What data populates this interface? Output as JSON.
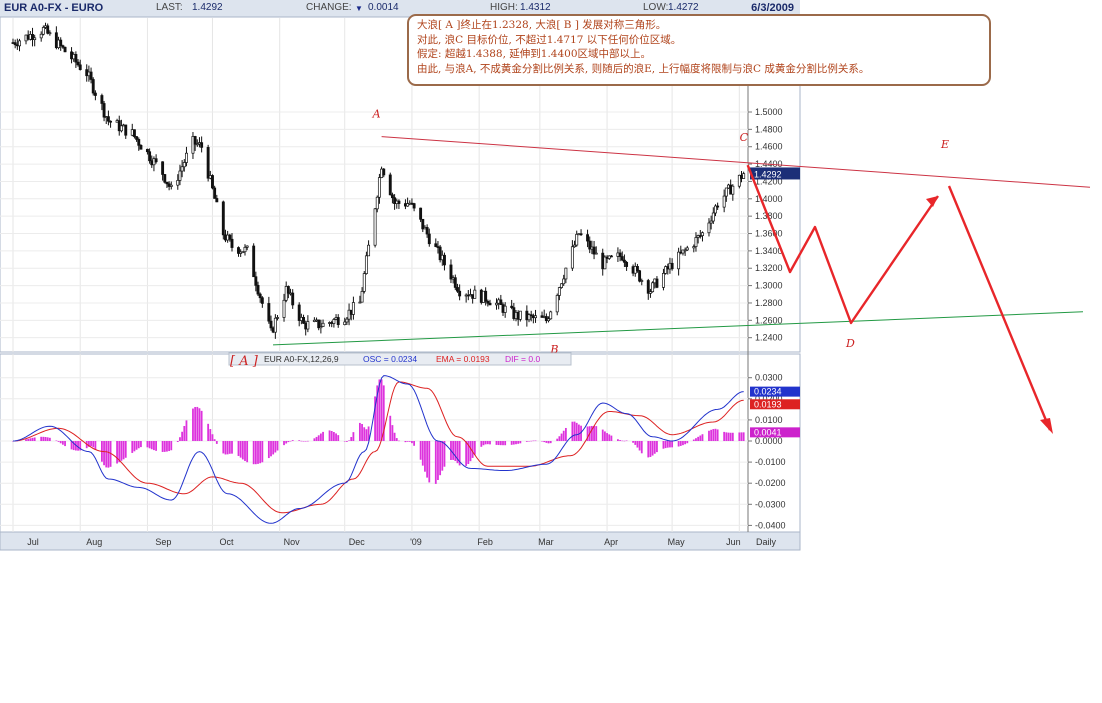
{
  "header": {
    "symbol": "EUR A0-FX - EURO",
    "last_label": "LAST:",
    "last_value": "1.4292",
    "change_label": "CHANGE:",
    "change_arrow": "▼",
    "change_value": "0.0014",
    "high_label": "HIGH:",
    "high_value": "1.4312",
    "low_label": "LOW:",
    "low_value": "1.4272",
    "date": "6/3/2009"
  },
  "annotation": {
    "lines": [
      "大浪[ A ]终止在1.2328, 大浪[ B ] 发展对称三角形。",
      "对此, 浪C 目标价位, 不超过1.4717 以下任何价位区域。",
      "假定: 超越1.4388, 延伸到1.4400区域中部以上。",
      "由此, 与浪A, 不成黄金分割比例关系, 则随后的浪E, 上行幅度将限制与浪C 成黄金分割比例关系。"
    ]
  },
  "colors": {
    "candles": "#111111",
    "osc_line": "#2233cc",
    "ema_line": "#dd2222",
    "dif_bars": "#dd33dd",
    "wave_projection": "#e8262a",
    "upper_trendline": "#cc3344",
    "lower_trendline": "#229944",
    "label_red": "#cc2222"
  },
  "chart_data": [
    {
      "type": "candlestick",
      "title": "EUR A0-FX - EURO",
      "price_axis_ticks": [
        "1.5000",
        "1.4800",
        "1.4600",
        "1.4400",
        "1.4200",
        "1.4000",
        "1.3800",
        "1.3600",
        "1.3400",
        "1.3200",
        "1.3000",
        "1.2800",
        "1.2600",
        "1.2400"
      ],
      "last_price_tag": "1.4292",
      "ylim": [
        1.23,
        1.51
      ],
      "x_ticks": [
        "Jul",
        "Aug",
        "Sep",
        "Oct",
        "Nov",
        "Dec",
        "'09",
        "Feb",
        "Mar",
        "Apr",
        "May",
        "Jun"
      ],
      "x_suffix": "Daily",
      "close_anchors": [
        {
          "date": "2008-07-01",
          "value": 1.58
        },
        {
          "date": "2008-07-15",
          "value": 1.595
        },
        {
          "date": "2008-07-23",
          "value": 1.575
        },
        {
          "date": "2008-08-04",
          "value": 1.545
        },
        {
          "date": "2008-08-14",
          "value": 1.49
        },
        {
          "date": "2008-08-25",
          "value": 1.475
        },
        {
          "date": "2008-09-08",
          "value": 1.43
        },
        {
          "date": "2008-09-12",
          "value": 1.41
        },
        {
          "date": "2008-09-22",
          "value": 1.465
        },
        {
          "date": "2008-09-26",
          "value": 1.46
        },
        {
          "date": "2008-10-06",
          "value": 1.36
        },
        {
          "date": "2008-10-10",
          "value": 1.345
        },
        {
          "date": "2008-10-17",
          "value": 1.34
        },
        {
          "date": "2008-10-28",
          "value": 1.245
        },
        {
          "date": "2008-11-04",
          "value": 1.295
        },
        {
          "date": "2008-11-12",
          "value": 1.255
        },
        {
          "date": "2008-11-21",
          "value": 1.255
        },
        {
          "date": "2008-12-01",
          "value": 1.265
        },
        {
          "date": "2008-12-08",
          "value": 1.28
        },
        {
          "date": "2008-12-18",
          "value": 1.44
        },
        {
          "date": "2008-12-24",
          "value": 1.395
        },
        {
          "date": "2008-12-31",
          "value": 1.395
        },
        {
          "date": "2009-01-09",
          "value": 1.355
        },
        {
          "date": "2009-01-23",
          "value": 1.295
        },
        {
          "date": "2009-02-05",
          "value": 1.285
        },
        {
          "date": "2009-02-18",
          "value": 1.265
        },
        {
          "date": "2009-03-04",
          "value": 1.26
        },
        {
          "date": "2009-03-19",
          "value": 1.36
        },
        {
          "date": "2009-03-30",
          "value": 1.325
        },
        {
          "date": "2009-04-08",
          "value": 1.335
        },
        {
          "date": "2009-04-21",
          "value": 1.295
        },
        {
          "date": "2009-05-01",
          "value": 1.325
        },
        {
          "date": "2009-05-15",
          "value": 1.36
        },
        {
          "date": "2009-05-22",
          "value": 1.395
        },
        {
          "date": "2009-06-03",
          "value": 1.4292
        }
      ],
      "annotations": [
        {
          "label": "[ A ]",
          "date": "2008-10-28",
          "value": 1.2328
        },
        {
          "label": "A",
          "date": "2008-12-18",
          "value": 1.4717
        },
        {
          "label": "B",
          "date": "2009-03-04",
          "value": 1.2456
        },
        {
          "label": "C",
          "date": "2009-06-03",
          "value": 1.4388
        },
        {
          "label": "D",
          "projected": true
        },
        {
          "label": "E",
          "projected": true
        }
      ]
    },
    {
      "type": "line",
      "title": "EUR A0-FX,12,26,9",
      "legend": [
        {
          "name": "OSC",
          "value": "0.0234"
        },
        {
          "name": "EMA",
          "value": "0.0193"
        },
        {
          "name": "DIF",
          "value": "0.0"
        }
      ],
      "axis_ticks": [
        "0.0300",
        "0.0200",
        "0.0100",
        "0.0000",
        "-0.0100",
        "-0.0200",
        "-0.0300",
        "-0.0400"
      ],
      "value_tags": [
        "0.0234",
        "0.0193",
        "0.0041"
      ],
      "ylim": [
        -0.041,
        0.034
      ],
      "series": [
        {
          "name": "OSC",
          "anchors": [
            {
              "date": "2008-07-01",
              "value": 0.0
            },
            {
              "date": "2008-07-18",
              "value": 0.007
            },
            {
              "date": "2008-08-05",
              "value": -0.005
            },
            {
              "date": "2008-08-14",
              "value": -0.018
            },
            {
              "date": "2008-08-28",
              "value": -0.022
            },
            {
              "date": "2008-09-12",
              "value": -0.028
            },
            {
              "date": "2008-09-25",
              "value": -0.005
            },
            {
              "date": "2008-10-08",
              "value": -0.025
            },
            {
              "date": "2008-10-28",
              "value": -0.039
            },
            {
              "date": "2008-11-10",
              "value": -0.032
            },
            {
              "date": "2008-12-01",
              "value": -0.02
            },
            {
              "date": "2008-12-10",
              "value": -0.005
            },
            {
              "date": "2008-12-19",
              "value": 0.031
            },
            {
              "date": "2008-12-30",
              "value": 0.027
            },
            {
              "date": "2009-01-13",
              "value": 0.0
            },
            {
              "date": "2009-01-28",
              "value": -0.013
            },
            {
              "date": "2009-02-13",
              "value": -0.014
            },
            {
              "date": "2009-03-04",
              "value": -0.011
            },
            {
              "date": "2009-03-18",
              "value": 0.003
            },
            {
              "date": "2009-03-30",
              "value": 0.018
            },
            {
              "date": "2009-04-10",
              "value": 0.013
            },
            {
              "date": "2009-04-22",
              "value": 0.002
            },
            {
              "date": "2009-05-01",
              "value": 0.0
            },
            {
              "date": "2009-05-22",
              "value": 0.015
            },
            {
              "date": "2009-06-03",
              "value": 0.0234
            }
          ]
        },
        {
          "name": "EMA",
          "anchors": [
            {
              "date": "2008-07-01",
              "value": 0.0
            },
            {
              "date": "2008-07-22",
              "value": 0.006
            },
            {
              "date": "2008-08-12",
              "value": -0.005
            },
            {
              "date": "2008-09-01",
              "value": -0.02
            },
            {
              "date": "2008-09-18",
              "value": -0.025
            },
            {
              "date": "2008-10-01",
              "value": -0.017
            },
            {
              "date": "2008-10-14",
              "value": -0.02
            },
            {
              "date": "2008-11-02",
              "value": -0.034
            },
            {
              "date": "2008-11-20",
              "value": -0.03
            },
            {
              "date": "2008-12-05",
              "value": -0.018
            },
            {
              "date": "2008-12-15",
              "value": -0.005
            },
            {
              "date": "2008-12-26",
              "value": 0.028
            },
            {
              "date": "2009-01-08",
              "value": 0.025
            },
            {
              "date": "2009-01-22",
              "value": 0.002
            },
            {
              "date": "2009-02-05",
              "value": -0.012
            },
            {
              "date": "2009-02-24",
              "value": -0.012
            },
            {
              "date": "2009-03-15",
              "value": -0.007
            },
            {
              "date": "2009-04-02",
              "value": 0.014
            },
            {
              "date": "2009-04-16",
              "value": 0.012
            },
            {
              "date": "2009-05-01",
              "value": 0.003
            },
            {
              "date": "2009-05-20",
              "value": 0.009
            },
            {
              "date": "2009-06-03",
              "value": 0.0193
            }
          ]
        }
      ]
    }
  ]
}
